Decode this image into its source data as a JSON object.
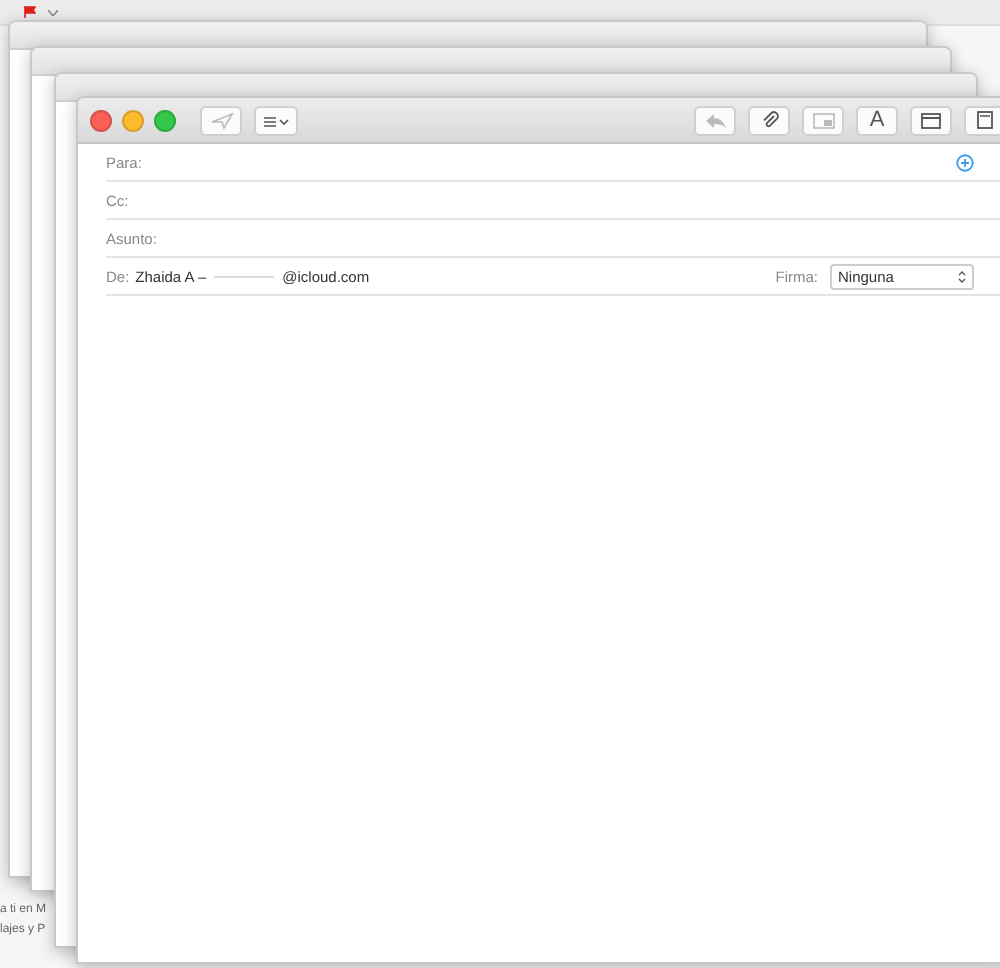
{
  "background_list": {
    "fragments": [
      "a ti en M",
      "lajes y P"
    ]
  },
  "compose": {
    "toolbar": {
      "send_disabled": true,
      "font_button": "A"
    },
    "fields": [
      {
        "kind": "recipient",
        "label": "Para:"
      },
      {
        "kind": "text",
        "label": "Cc:"
      },
      {
        "kind": "text",
        "label": "Asunto:"
      }
    ],
    "from": {
      "label": "De:",
      "name": "Zhaida A –",
      "domain": "@icloud.com",
      "signature_label": "Firma:",
      "signature": "Ninguna"
    }
  }
}
